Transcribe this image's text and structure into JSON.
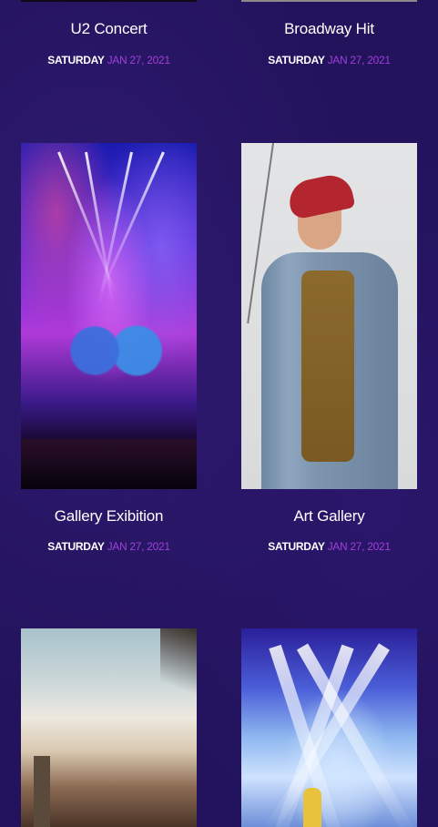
{
  "events": [
    {
      "title": "U2 Concert",
      "day": "SATURDAY",
      "date": "JAN 27, 2021",
      "image": "event-image-u2-concert"
    },
    {
      "title": "Broadway Hit",
      "day": "SATURDAY",
      "date": "JAN 27, 2021",
      "image": "event-image-broadway-hit"
    },
    {
      "title": "Gallery Exibition",
      "day": "SATURDAY",
      "date": "JAN 27, 2021",
      "image": "concert-stage-photo"
    },
    {
      "title": "Art Gallery",
      "day": "SATURDAY",
      "date": "JAN 27, 2021",
      "image": "man-in-denim-jacket-photo"
    },
    {
      "image": "festival-crowd-photo"
    },
    {
      "image": "stage-lights-photo"
    }
  ],
  "colors": {
    "background": "#23135d",
    "title": "#ffffff",
    "day": "#ffffff",
    "date_accent": "#a03fd8"
  }
}
